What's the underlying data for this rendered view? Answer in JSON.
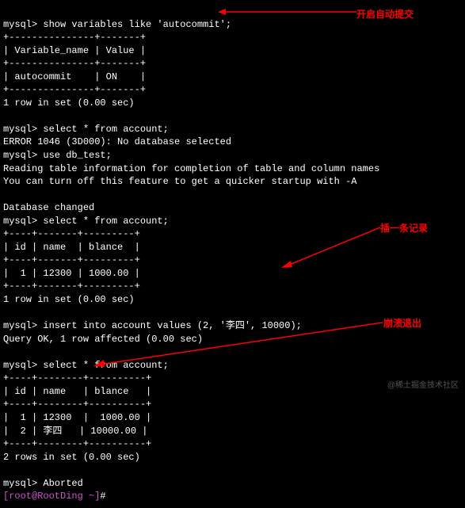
{
  "lines": {
    "l1": "mysql> show variables like 'autocommit';",
    "l2": "+---------------+-------+",
    "l3": "| Variable_name | Value |",
    "l4": "+---------------+-------+",
    "l5": "| autocommit    | ON    |",
    "l6": "+---------------+-------+",
    "l7": "1 row in set (0.00 sec)",
    "l8": "",
    "l9": "mysql> select * from account;",
    "l10": "ERROR 1046 (3D000): No database selected",
    "l11": "mysql> use db_test;",
    "l12": "Reading table information for completion of table and column names",
    "l13": "You can turn off this feature to get a quicker startup with -A",
    "l14": "",
    "l15": "Database changed",
    "l16": "mysql> select * from account;",
    "l17": "+----+-------+---------+",
    "l18": "| id | name  | blance  |",
    "l19": "+----+-------+---------+",
    "l20": "|  1 | 12300 | 1000.00 |",
    "l21": "+----+-------+---------+",
    "l22": "1 row in set (0.00 sec)",
    "l23": "",
    "l24": "mysql> insert into account values (2, '李四', 10000);",
    "l25": "Query OK, 1 row affected (0.00 sec)",
    "l26": "",
    "l27": "mysql> select * from account;",
    "l28": "+----+--------+----------+",
    "l29": "| id | name   | blance   |",
    "l30": "+----+--------+----------+",
    "l31": "|  1 | 12300  |  1000.00 |",
    "l32": "|  2 | 李四   | 10000.00 |",
    "l33": "+----+--------+----------+",
    "l34": "2 rows in set (0.00 sec)",
    "l35": "",
    "l36": "mysql> Aborted",
    "l37a": "[root@RootDing ~]",
    "l37b": "# "
  },
  "labels": {
    "autocommit": "开启自动提交",
    "insert": "插一条记录",
    "abort": "崩溃退出"
  },
  "watermark": "@稀土掘金技术社区"
}
